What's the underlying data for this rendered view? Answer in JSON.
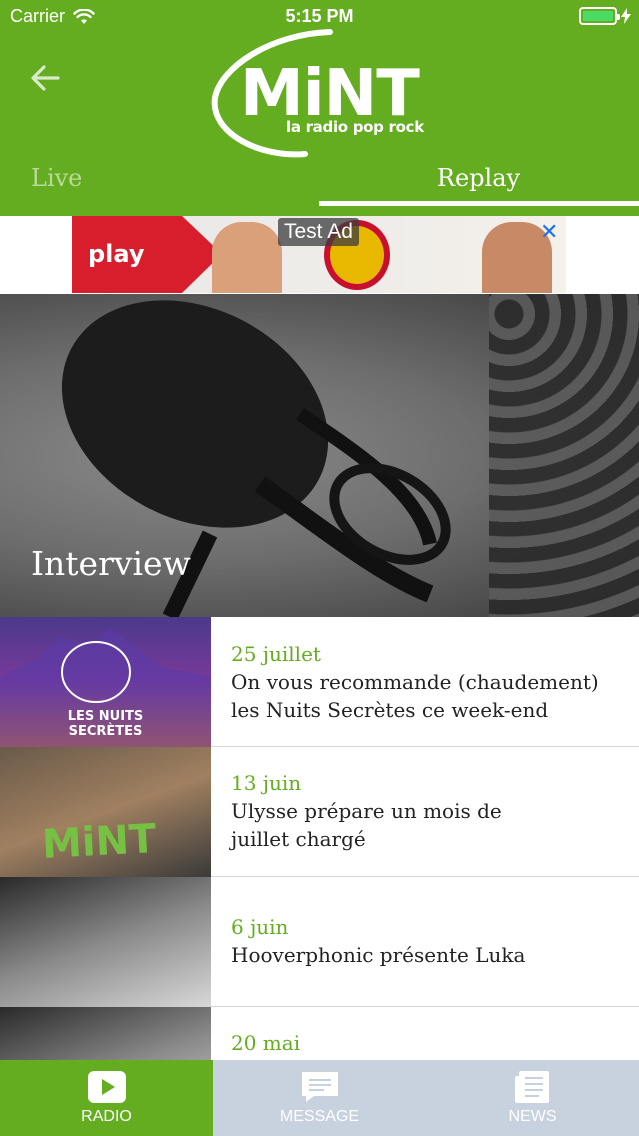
{
  "status_bar": {
    "carrier": "Carrier",
    "time": "5:15 PM"
  },
  "header": {
    "logo": {
      "wordmark": "MiNT",
      "tagline": "la radio pop rock"
    },
    "tabs": [
      {
        "label": "Live",
        "active": false
      },
      {
        "label": "Replay",
        "active": true
      }
    ]
  },
  "ad": {
    "label": "Test Ad",
    "creative_text": "play",
    "close": "✕"
  },
  "hero": {
    "title": "Interview"
  },
  "articles": [
    {
      "date": "25 juillet",
      "title": "On vous recommande (chaudement) les Nuits Secrètes ce week-end",
      "thumb_text": "LES NUITS\nSECRÈTES"
    },
    {
      "date": "13 juin",
      "title": "Ulysse prépare un mois de juillet chargé",
      "thumb_text": "MiNT"
    },
    {
      "date": "6 juin",
      "title": "Hooverphonic présente Luka"
    },
    {
      "date": "20 mai",
      "title": ""
    }
  ],
  "tabbar": [
    {
      "label": "RADIO",
      "icon": "play-icon",
      "active": true
    },
    {
      "label": "MESSAGE",
      "icon": "message-icon",
      "active": false
    },
    {
      "label": "NEWS",
      "icon": "news-icon",
      "active": false
    }
  ],
  "colors": {
    "brand_green": "#64ad21",
    "tabbar_bg": "#c8d2df",
    "ad_close_blue": "#1a73e8"
  }
}
